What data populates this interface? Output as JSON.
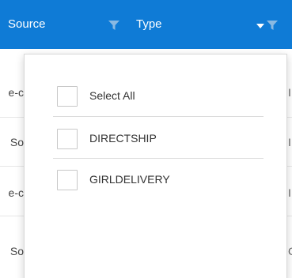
{
  "header": {
    "source_label": "Source",
    "type_label": "Type",
    "background_color": "#0f7bd6",
    "filter_icon_color": "#8ab9e2",
    "icons": [
      "filter-icon",
      "sort-down-icon"
    ]
  },
  "grid": {
    "rows": [
      {
        "left_fragment": "e-c",
        "right_fragment": "I"
      },
      {
        "left_fragment": "So",
        "right_fragment": "I"
      },
      {
        "left_fragment": "e-c",
        "right_fragment": "I"
      },
      {
        "left_fragment": "So",
        "right_fragment": "C"
      }
    ]
  },
  "filter_popup": {
    "options": [
      {
        "label": "Select All",
        "checked": false
      },
      {
        "label": "DIRECTSHIP",
        "checked": false
      },
      {
        "label": "GIRLDELIVERY",
        "checked": false
      }
    ]
  }
}
